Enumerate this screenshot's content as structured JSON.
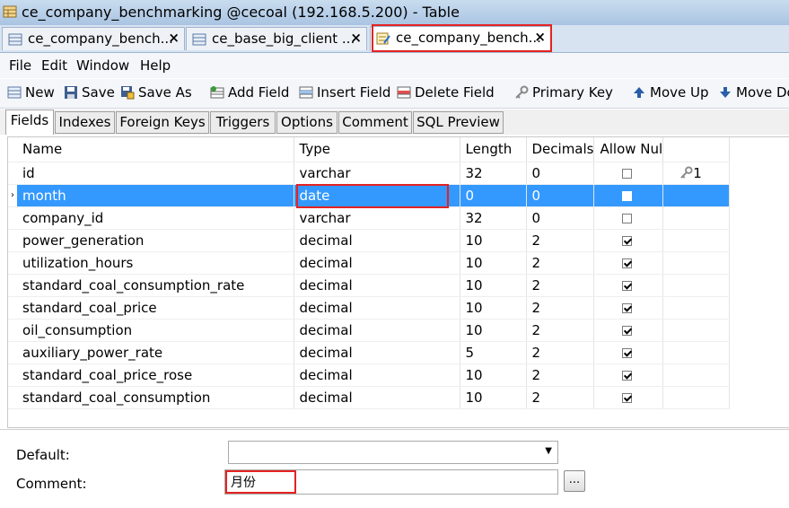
{
  "window": {
    "title": "ce_company_benchmarking @cecoal (192.168.5.200) - Table"
  },
  "tabs": [
    {
      "label": "ce_company_bench...",
      "close": "×"
    },
    {
      "label": "ce_base_big_client ...",
      "close": "×"
    },
    {
      "label": "ce_company_bench...",
      "close": "×"
    }
  ],
  "menu": [
    "File",
    "Edit",
    "Window",
    "Help"
  ],
  "toolbar": {
    "new": "New",
    "save": "Save",
    "save_as": "Save As",
    "add_field": "Add Field",
    "insert_field": "Insert Field",
    "delete_field": "Delete Field",
    "primary_key": "Primary Key",
    "move_up": "Move Up",
    "move_down": "Move Do"
  },
  "subtabs": [
    "Fields",
    "Indexes",
    "Foreign Keys",
    "Triggers",
    "Options",
    "Comment",
    "SQL Preview"
  ],
  "grid": {
    "headers": [
      "Name",
      "Type",
      "Length",
      "Decimals",
      "Allow Nul",
      ""
    ],
    "rows": [
      {
        "name": "id",
        "type": "varchar",
        "length": "32",
        "decimals": "0",
        "allow_null": false,
        "key": "1"
      },
      {
        "name": "month",
        "type": "date",
        "length": "0",
        "decimals": "0",
        "allow_null": false,
        "key": ""
      },
      {
        "name": "company_id",
        "type": "varchar",
        "length": "32",
        "decimals": "0",
        "allow_null": false,
        "key": ""
      },
      {
        "name": "power_generation",
        "type": "decimal",
        "length": "10",
        "decimals": "2",
        "allow_null": true,
        "key": ""
      },
      {
        "name": "utilization_hours",
        "type": "decimal",
        "length": "10",
        "decimals": "2",
        "allow_null": true,
        "key": ""
      },
      {
        "name": "standard_coal_consumption_rate",
        "type": "decimal",
        "length": "10",
        "decimals": "2",
        "allow_null": true,
        "key": ""
      },
      {
        "name": "standard_coal_price",
        "type": "decimal",
        "length": "10",
        "decimals": "2",
        "allow_null": true,
        "key": ""
      },
      {
        "name": "oil_consumption",
        "type": "decimal",
        "length": "10",
        "decimals": "2",
        "allow_null": true,
        "key": ""
      },
      {
        "name": "auxiliary_power_rate",
        "type": "decimal",
        "length": "5",
        "decimals": "2",
        "allow_null": true,
        "key": ""
      },
      {
        "name": "standard_coal_price_rose",
        "type": "decimal",
        "length": "10",
        "decimals": "2",
        "allow_null": true,
        "key": ""
      },
      {
        "name": "standard_coal_consumption",
        "type": "decimal",
        "length": "10",
        "decimals": "2",
        "allow_null": true,
        "key": ""
      }
    ],
    "selected_index": 1,
    "row_indicator": "›"
  },
  "properties": {
    "default_label": "Default:",
    "default_value": "",
    "comment_label": "Comment:",
    "comment_value": "月份",
    "browse_label": "..."
  },
  "icons": {
    "title": "table-icon",
    "tab": "table-icon",
    "new": "new-doc-icon",
    "save": "save-icon",
    "save_as": "save-as-icon",
    "add_field": "add-field-icon",
    "insert_field": "insert-field-icon",
    "delete_field": "delete-field-icon",
    "primary_key": "key-icon",
    "move_up": "arrow-up-icon",
    "move_down": "arrow-down-icon"
  },
  "colors": {
    "selection": "#3399ff",
    "highlight_box": "#e52222"
  }
}
